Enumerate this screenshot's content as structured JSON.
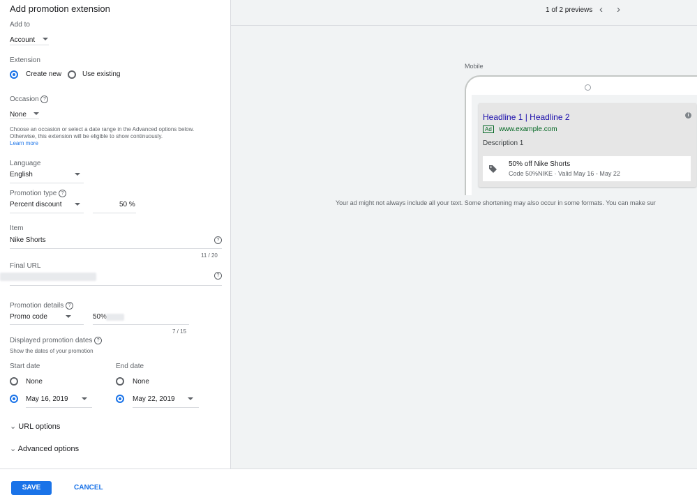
{
  "panel": {
    "title": "Add promotion extension",
    "add_to_label": "Add to",
    "add_to_value": "Account",
    "extension_label": "Extension",
    "create_new": "Create new",
    "use_existing": "Use existing",
    "occasion_label": "Occasion",
    "occasion_value": "None",
    "occasion_help": "Choose an occasion or select a date range in the Advanced options below. Otherwise, this extension will be eligible to show continuously.",
    "learn_more": "Learn more",
    "language_label": "Language",
    "language_value": "English",
    "promotion_type_label": "Promotion type",
    "promotion_type_value": "Percent discount",
    "percent_value": "50",
    "percent_suffix": "%",
    "item_label": "Item",
    "item_value": "Nike Shorts",
    "item_count": "11 / 20",
    "final_url_label": "Final URL",
    "promotion_details_label": "Promotion details",
    "promotion_details_value": "Promo code",
    "promo_code_value": "50%",
    "promo_count": "7 / 15",
    "displayed_dates_label": "Displayed promotion dates",
    "displayed_dates_sub": "Show the dates of your promotion",
    "start_date_label": "Start date",
    "end_date_label": "End date",
    "none_label": "None",
    "start_date_value": "May 16, 2019",
    "end_date_value": "May 22, 2019",
    "url_options": "URL options",
    "advanced_options": "Advanced options",
    "help_glyph": "?"
  },
  "footer": {
    "save": "SAVE",
    "cancel": "CANCEL"
  },
  "preview": {
    "counter": "1 of 2 previews",
    "prev_glyph": "‹",
    "next_glyph": "›",
    "device_label": "Mobile",
    "headline": "Headline 1 | Headline 2",
    "ad_badge": "Ad",
    "display_url": "www.example.com",
    "description": "Description 1",
    "promo_title": "50% off Nike Shorts",
    "promo_detail": "Code 50%NIKE  ·  Valid May 16 - May 22",
    "info_glyph": "i",
    "disclaimer": "Your ad might not always include all your text. Some shortening may also occur in some formats. You can make sur"
  },
  "colors": {
    "accent": "#1a73e8",
    "headline_link": "#1a0dab",
    "url_green": "#006621"
  }
}
